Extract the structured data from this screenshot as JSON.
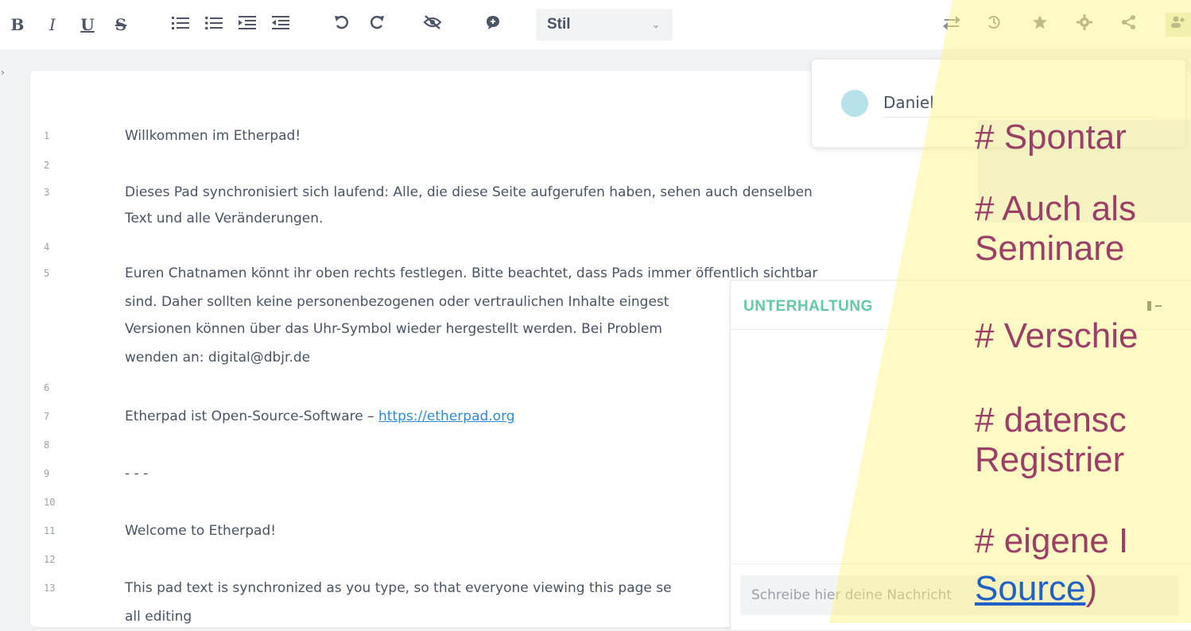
{
  "toolbar": {
    "bold": "B",
    "italic": "I",
    "underline": "U",
    "strike": "S",
    "style_select": "Stil",
    "chev": "⌄"
  },
  "editor": {
    "lines": [
      {
        "n": "1",
        "text": "Willkommen im Etherpad!"
      },
      {
        "n": "2",
        "text": ""
      },
      {
        "n": "3",
        "text": "Dieses Pad synchronisiert sich laufend: Alle, die diese Seite aufgerufen haben, sehen auch denselben"
      },
      {
        "n": "",
        "text": "Text und alle Veränderungen."
      },
      {
        "n": "4",
        "text": ""
      },
      {
        "n": "5",
        "text": "Euren Chatnamen könnt ihr oben rechts festlegen. Bitte beachtet, dass Pads immer öffentlich sichtbar"
      },
      {
        "n": "",
        "text": "sind. Daher sollten keine personenbezogenen oder vertraulichen Inhalte eingest"
      },
      {
        "n": "",
        "text": "Versionen können über das Uhr-Symbol wieder hergestellt werden. Bei Problem"
      },
      {
        "n": "",
        "text": "wenden an: digital@dbjr.de"
      },
      {
        "n": "6",
        "text": ""
      },
      {
        "n": "7",
        "text": "Etherpad ist Open-Source-Software – ",
        "link": "https://etherpad.org"
      },
      {
        "n": "8",
        "text": ""
      },
      {
        "n": "9",
        "text": "- - -"
      },
      {
        "n": "10",
        "text": ""
      },
      {
        "n": "11",
        "text": "Welcome to Etherpad!"
      },
      {
        "n": "12",
        "text": ""
      },
      {
        "n": "13",
        "text": "This pad text is synchronized as you type, so that everyone viewing this page se"
      },
      {
        "n": "",
        "text": "all editing"
      }
    ]
  },
  "users": {
    "name": "Daniel",
    "color": "#b8e2ea"
  },
  "chat": {
    "title": "UNTERHALTUNG",
    "placeholder": "Schreibe hier deine Nachricht"
  },
  "slide": {
    "highlight_color": "#fff27a",
    "bullets": [
      "# Spontar",
      "# Auch als",
      "Seminare",
      "# Verschie",
      "# datensc",
      "Registrier",
      "# eigene I"
    ],
    "source_link": "Source",
    "source_tail": ")"
  }
}
